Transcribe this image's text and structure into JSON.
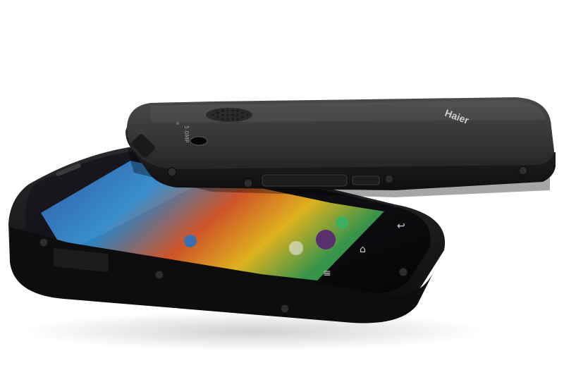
{
  "scene": {
    "description_colors": {
      "background": "#ffffff",
      "phone_body": "#2b2b2c",
      "phone_edge": "#141415",
      "screen_glass": "#0c0c10"
    },
    "back_phone": {
      "brand_logo": "Haier",
      "camera_label": "5.0MP"
    },
    "front_phone": {
      "nav_icons": [
        "back-icon",
        "home-icon",
        "menu-icon"
      ]
    }
  }
}
